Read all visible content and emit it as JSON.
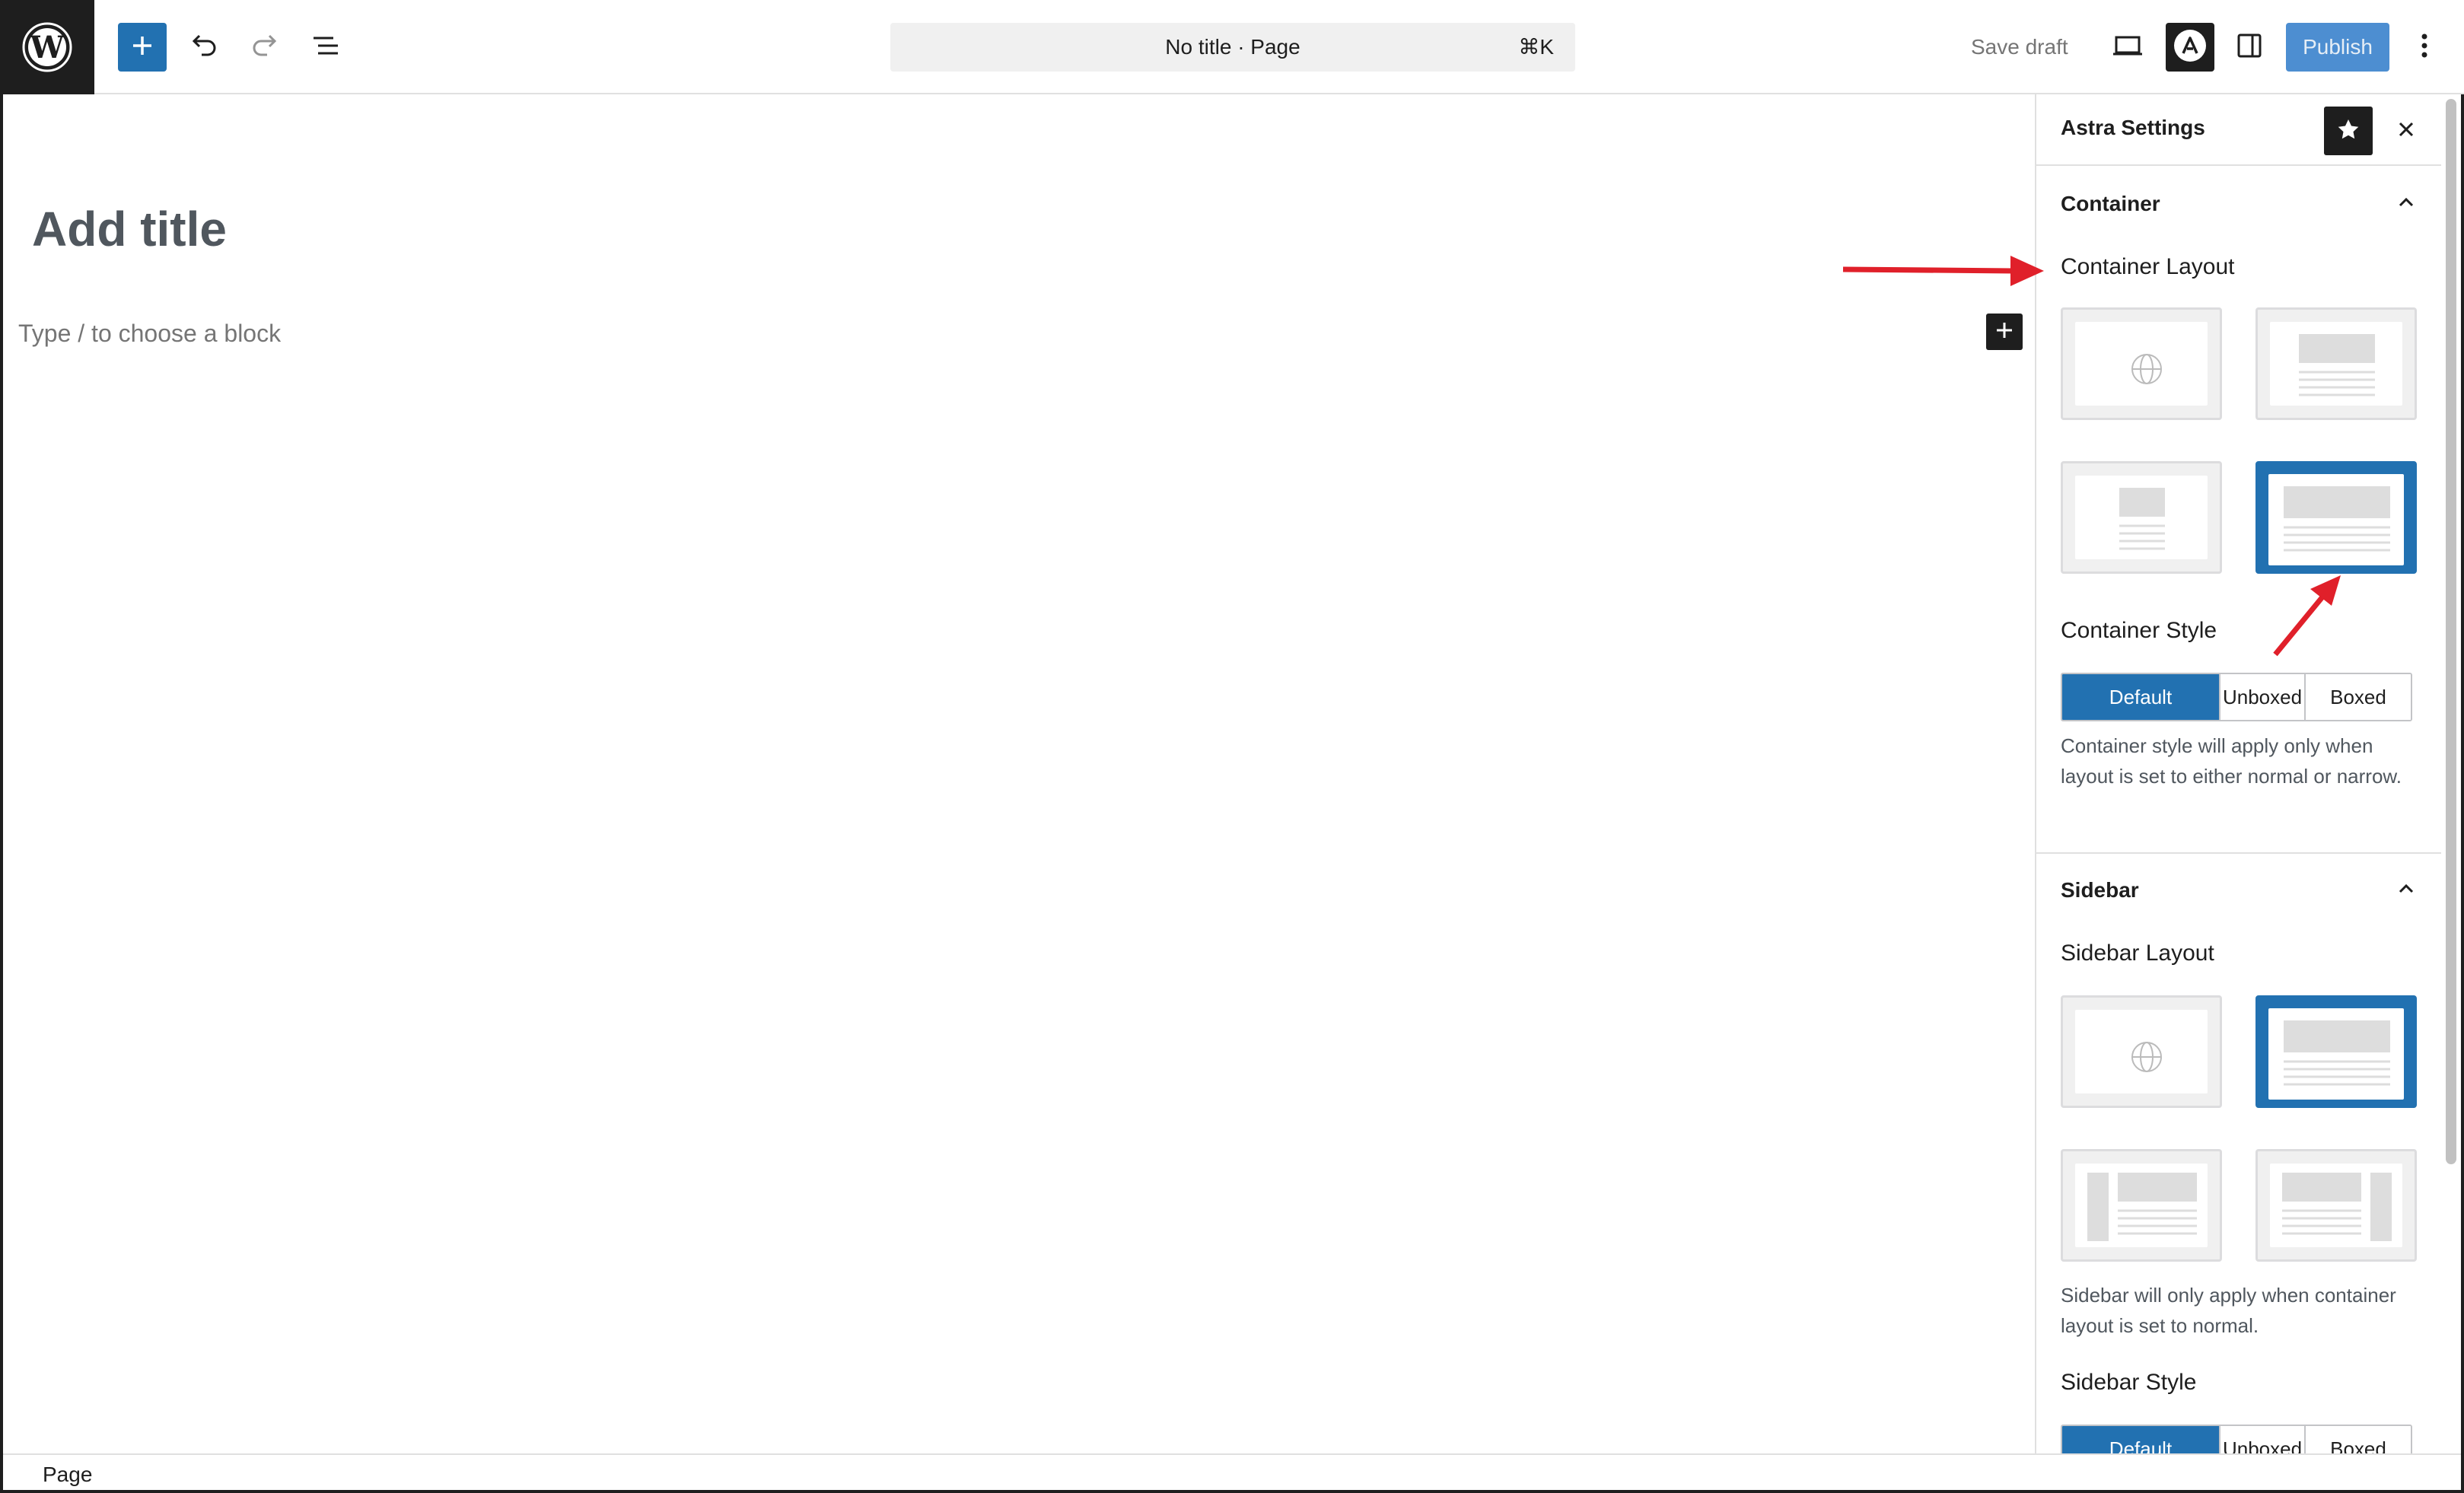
{
  "toolbar": {
    "app_logo": "wordpress-logo-icon",
    "command_title": "No title · Page",
    "command_shortcut": "⌘K",
    "save_draft_label": "Save draft",
    "publish_label": "Publish",
    "icons": [
      "plus-icon",
      "undo-icon",
      "redo-icon",
      "document-overview-icon",
      "desktop-preview-icon",
      "astra-icon",
      "sidebar-toggle-icon",
      "more-options-icon"
    ]
  },
  "editor": {
    "title_placeholder": "Add title",
    "block_placeholder": "Type / to choose a block"
  },
  "sidebar": {
    "title": "Astra Settings",
    "container_panel": {
      "heading": "Container",
      "layout_label": "Container Layout",
      "style_label": "Container Style",
      "style_options": [
        "Default",
        "Unboxed",
        "Boxed"
      ],
      "style_selected": "Default",
      "style_help": "Container style will apply only when layout is set to either normal or narrow.",
      "selected_layout_index": 3
    },
    "sidebar_panel": {
      "heading": "Sidebar",
      "layout_label": "Sidebar Layout",
      "layout_help": "Sidebar will only apply when container layout is set to normal.",
      "style_label": "Sidebar Style",
      "style_options": [
        "Default",
        "Unboxed",
        "Boxed"
      ],
      "style_selected": "Default",
      "selected_layout_index": 1
    }
  },
  "footer": {
    "breadcrumb": "Page"
  },
  "colors": {
    "accent": "#2271b1",
    "annotation_arrow": "#e0202a",
    "dark": "#1e1e1e"
  }
}
